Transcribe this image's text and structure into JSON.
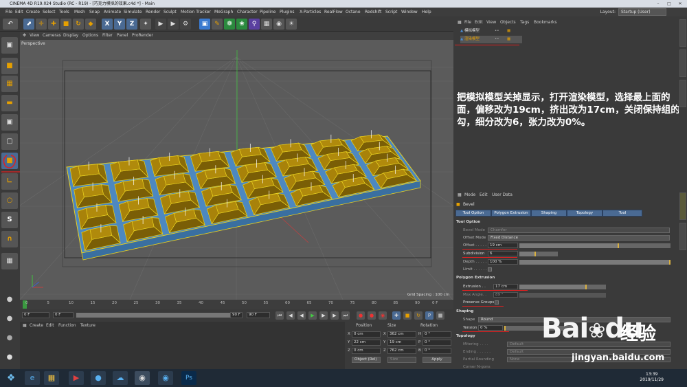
{
  "window": {
    "title": "CINEMA 4D R19.024 Studio (RC - R19) - [巧克力模拟的效果.c4d *] - Main"
  },
  "menu": [
    "File",
    "Edit",
    "Create",
    "Select",
    "Tools",
    "Mesh",
    "Snap",
    "Animate",
    "Simulate",
    "Render",
    "Sculpt",
    "Motion Tracker",
    "MoGraph",
    "Character",
    "Pipeline",
    "Plugins",
    "X-Particles",
    "RealFlow",
    "Octane",
    "Redshift",
    "Script",
    "Window",
    "Help"
  ],
  "layout": {
    "label": "Layout:",
    "value": "Startup (User)"
  },
  "viewport": {
    "menu": [
      "View",
      "Cameras",
      "Display",
      "Options",
      "Filter",
      "Panel",
      "ProRender"
    ],
    "label": "Perspective",
    "grid_spacing": "Grid Spacing : 100 cm"
  },
  "timeline": {
    "ticks": [
      "0",
      "5",
      "10",
      "15",
      "20",
      "25",
      "30",
      "35",
      "40",
      "45",
      "50",
      "55",
      "60",
      "65",
      "70",
      "75",
      "80",
      "85",
      "90"
    ],
    "end_label": "0 F",
    "start_field": "0 F",
    "min_field": "0 F",
    "max_field": "90 F",
    "end_field": "90 F"
  },
  "material_manager": {
    "menu": [
      "Create",
      "Edit",
      "Function",
      "Texture"
    ]
  },
  "coordinates": {
    "headers": [
      "Position",
      "Size",
      "Rotation"
    ],
    "rows": [
      {
        "axis": "X",
        "pos": "0 cm",
        "size_axis": "X",
        "size": "362 cm",
        "rot_axis": "H",
        "rot": "0 °"
      },
      {
        "axis": "Y",
        "pos": "22 cm",
        "size_axis": "Y",
        "size": "19 cm",
        "rot_axis": "P",
        "rot": "0 °"
      },
      {
        "axis": "Z",
        "pos": "0 cm",
        "size_axis": "Z",
        "size": "762 cm",
        "rot_axis": "B",
        "rot": "0 °"
      }
    ],
    "mode": "Object (Rel)",
    "size_mode": "Size",
    "apply": "Apply"
  },
  "object_manager": {
    "menu": [
      "File",
      "Edit",
      "View",
      "Objects",
      "Tags",
      "Bookmarks"
    ],
    "objects": [
      "模拟模型",
      "渲染模型"
    ]
  },
  "annotation": "把模拟模型关掉显示，打开渲染模型，选择最上面的面，偏移改为19cm，挤出改为17cm，关闭保持组的勾，细分改为6，张力改为0%。",
  "attributes": {
    "menu": [
      "Mode",
      "Edit",
      "User Data"
    ],
    "tool_name": "Bevel",
    "tabs": [
      "Tool Option",
      "Polygon Extrusion",
      "Shaping",
      "Topology",
      "Tool"
    ],
    "sections": {
      "tool_option": "Tool Option",
      "polygon_extrusion": "Polygon Extrusion",
      "shaping": "Shaping",
      "topology": "Topology"
    },
    "params": {
      "bevel_mode": {
        "label": "Bevel Mode",
        "value": "Chamfer"
      },
      "offset_mode": {
        "label": "Offset Mode",
        "value": "Fixed Distance"
      },
      "offset": {
        "label": "Offset . . . . .",
        "value": "19 cm",
        "fill": 0.66
      },
      "subdivision": {
        "label": "Subdivision",
        "value": "6",
        "fill": 0.42
      },
      "depth": {
        "label": "Depth . . . . .",
        "value": "100 %",
        "fill": 1.0
      },
      "limit": {
        "label": "Limit . . . . . ."
      },
      "extrusion": {
        "label": "Extrusion . .",
        "value": "17 cm",
        "fill": 0.78
      },
      "max_angle": {
        "label": "Max Angle. .",
        "value": "89 °"
      },
      "preserve_groups": {
        "label": "Preserve Groups"
      },
      "shape": {
        "label": "Shape",
        "value": "Round"
      },
      "tension": {
        "label": "Tension . . .",
        "value": "0 %",
        "fill": 0.0
      },
      "mitering": {
        "label": "Mitering . . . .",
        "value": "Default"
      },
      "ending": {
        "label": "Ending . . . . . .",
        "value": "Default"
      },
      "partial_rounding": {
        "label": "Partial Rounding",
        "value": "None"
      },
      "corner_ngons": {
        "label": "Corner N-gons"
      }
    }
  },
  "taskbar": {
    "time": "13:39",
    "date": "2019/11/29"
  },
  "watermark": {
    "logo": "Bai",
    "logo_suffix": "du",
    "cn": "经验",
    "url": "jingyan.baidu.com"
  },
  "colors": {
    "accent_tab": "#4a6a93",
    "chocolate": "#a8820a",
    "selection": "#e8d020",
    "annotation_red": "#e02020"
  }
}
